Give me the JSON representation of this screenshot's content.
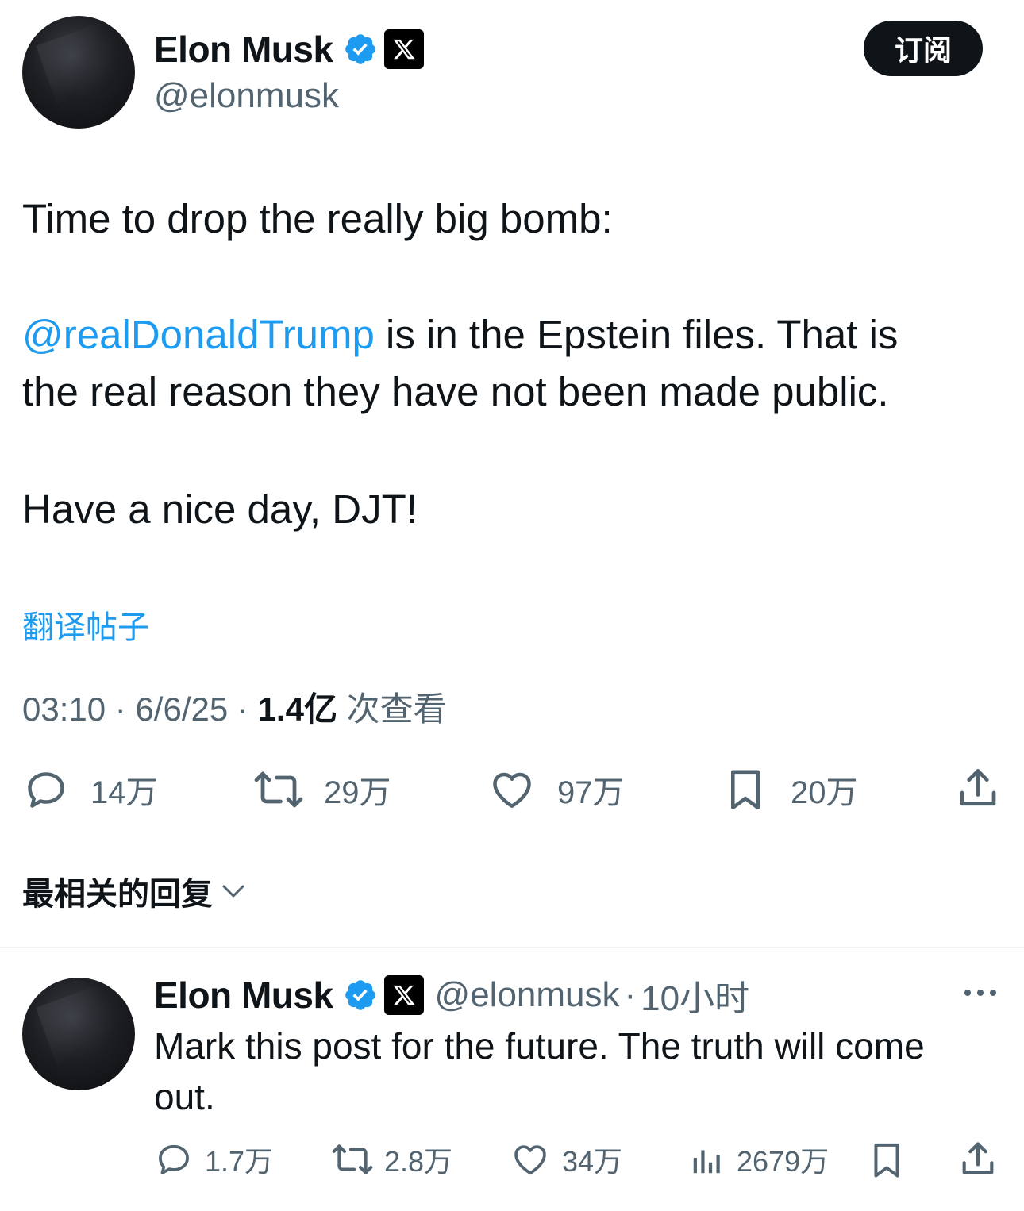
{
  "tweet": {
    "author_name": "Elon Musk",
    "author_handle": "@elonmusk",
    "subscribe_label": "订阅",
    "line1": "Time to drop the really big bomb:",
    "mention": "@realDonaldTrump",
    "line2_rest": " is in the Epstein files. That is",
    "line3": "the real reason they have not been made public.",
    "line4": "Have a nice day, DJT!",
    "translate_label": "翻译帖子",
    "time": "03:10",
    "date": "6/6/25",
    "views_count": "1.4亿",
    "views_label": "次查看",
    "separator": "·"
  },
  "actions": {
    "replies": "14万",
    "reposts": "29万",
    "likes": "97万",
    "bookmarks": "20万"
  },
  "replies_header": {
    "label": "最相关的回复"
  },
  "reply": {
    "author_name": "Elon Musk",
    "author_handle": "@elonmusk",
    "time_ago": "10小时",
    "separator": "·",
    "text": "Mark this post for the future. The truth will come out.",
    "actions": {
      "replies": "1.7万",
      "reposts": "2.8万",
      "likes": "34万",
      "views": "2679万"
    }
  },
  "colors": {
    "accent": "#1d9bf0",
    "text_primary": "#0f1419",
    "text_secondary": "#536471"
  }
}
